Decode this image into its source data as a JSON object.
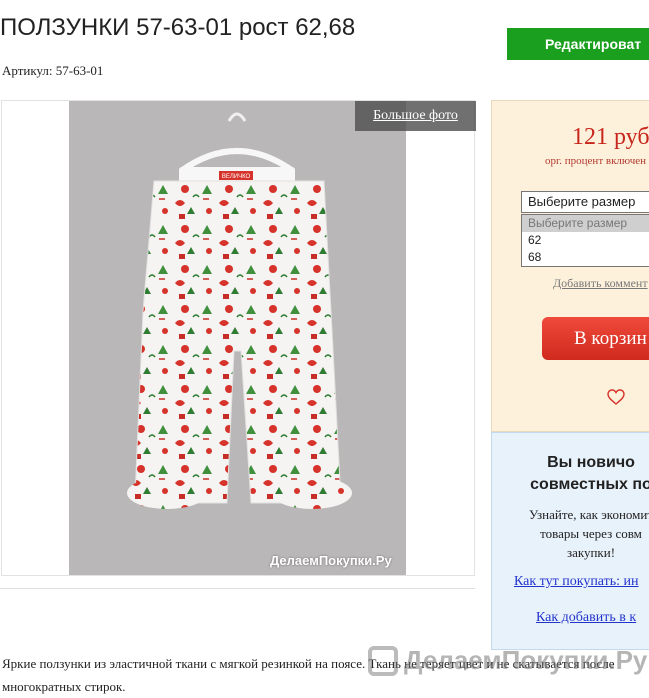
{
  "product": {
    "title": "ПОЛЗУНКИ 57-63-01 рост 62,68",
    "article": "Артикул: 57-63-01"
  },
  "toolbar": {
    "edit_label": "Редактироват"
  },
  "photo": {
    "big_photo_label": "Большое фото",
    "watermark": "ДелаемПокупки.Ру",
    "tag_text": "ВЕЛИЧКО"
  },
  "buy": {
    "price": "121 руб",
    "org_note": "орг. процент включен",
    "size_select": {
      "selected": "Выберите размер",
      "options": [
        "Выберите размер",
        "62",
        "68"
      ]
    },
    "add_comment": "Добавить коммент",
    "cart_label": "В корзин",
    "heart_icon": "heart-icon"
  },
  "info": {
    "heading": "Вы новичо\nсовместных по",
    "text": "Узнайте, как экономит\nтовары через совм\nзакупки!",
    "link_how": "Как тут покупать: ин",
    "link_add": "Как добавить в к"
  },
  "description": "Яркие ползунки из эластичной ткани с мягкой резинкой на поясе. Ткань не теряет цвет и не скатывается после многократных стирок.",
  "watermark_big": "ДелаемПокупки.Ру",
  "colors": {
    "edit_button": "#1aa01e",
    "price": "#c8261c",
    "cart_button": "#e03528",
    "link": "#2233cc",
    "buy_panel": "#fdf1dc",
    "info_panel": "#e8f2fb"
  }
}
